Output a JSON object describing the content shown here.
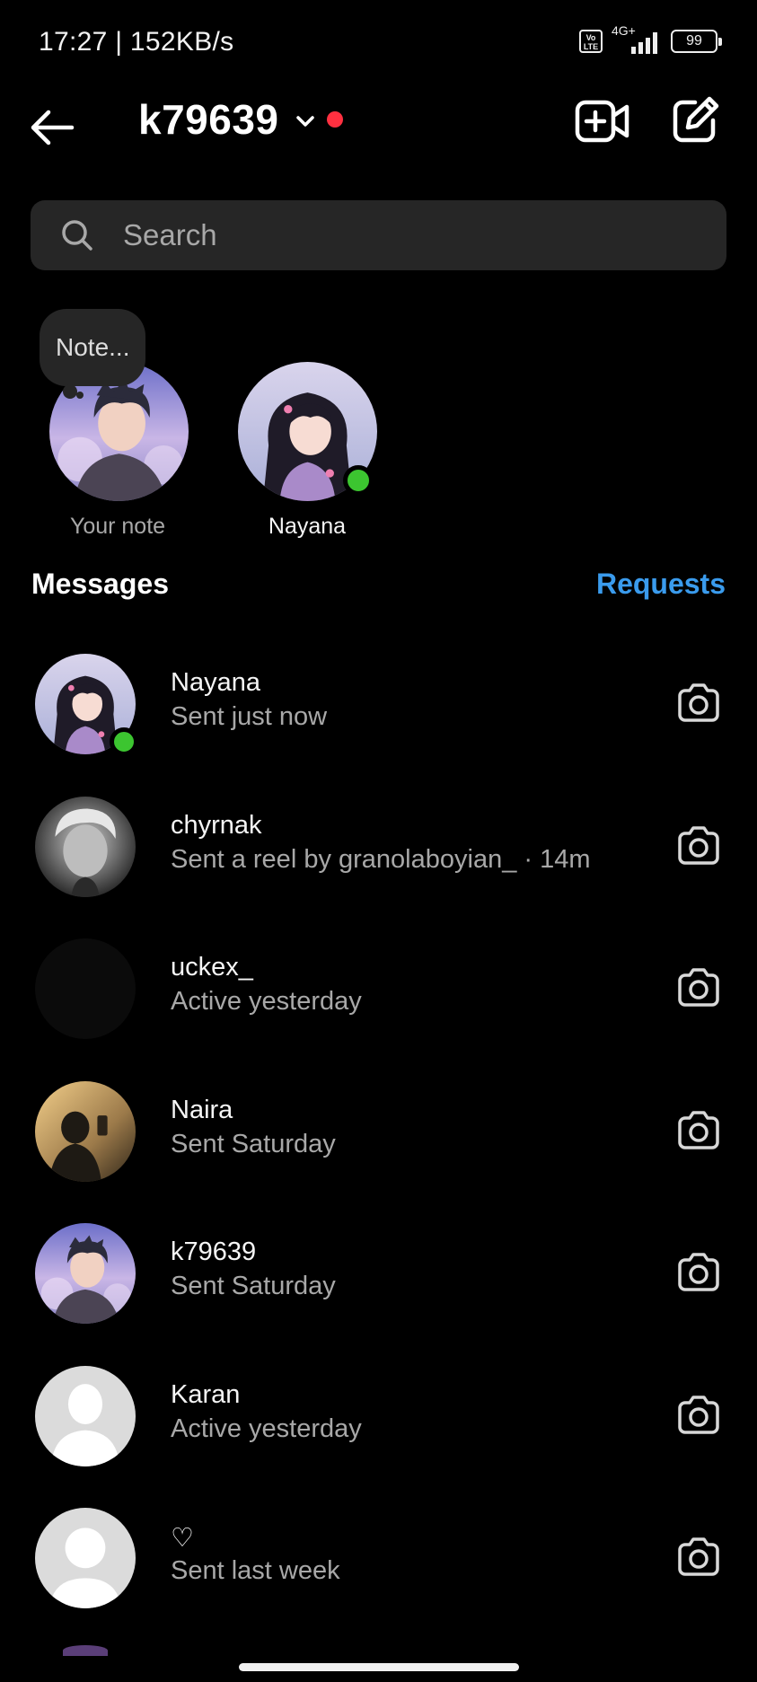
{
  "status_bar": {
    "time": "17:27 | 152KB/s",
    "volte": "Vo LTE",
    "network": "4G+",
    "battery": "99"
  },
  "header": {
    "username": "k79639"
  },
  "search": {
    "placeholder": "Search"
  },
  "notes": [
    {
      "label": "Your note",
      "bubble": "Note..."
    },
    {
      "label": "Nayana"
    }
  ],
  "messages_section": {
    "title": "Messages",
    "requests": "Requests"
  },
  "messages": [
    {
      "name": "Nayana",
      "subtitle": "Sent just now",
      "online": true
    },
    {
      "name": "chyrnak",
      "subtitle": "Sent a reel by granolaboyian_ · 14m"
    },
    {
      "name": "uckex_",
      "subtitle": "Active yesterday"
    },
    {
      "name": "Naira",
      "subtitle": "Sent Saturday"
    },
    {
      "name": "k79639",
      "subtitle": "Sent Saturday"
    },
    {
      "name": "Karan",
      "subtitle": "Active yesterday"
    },
    {
      "name": "♡",
      "subtitle": "Sent last week"
    }
  ],
  "colors": {
    "background": "#000000",
    "search_bg": "#262626",
    "requests_link": "#3a9bed",
    "online": "#3cc530",
    "notification_dot": "#ff3040"
  },
  "icons": [
    "back-arrow-icon",
    "chevron-down-icon",
    "video-call-add-icon",
    "compose-icon",
    "search-icon",
    "camera-icon"
  ]
}
